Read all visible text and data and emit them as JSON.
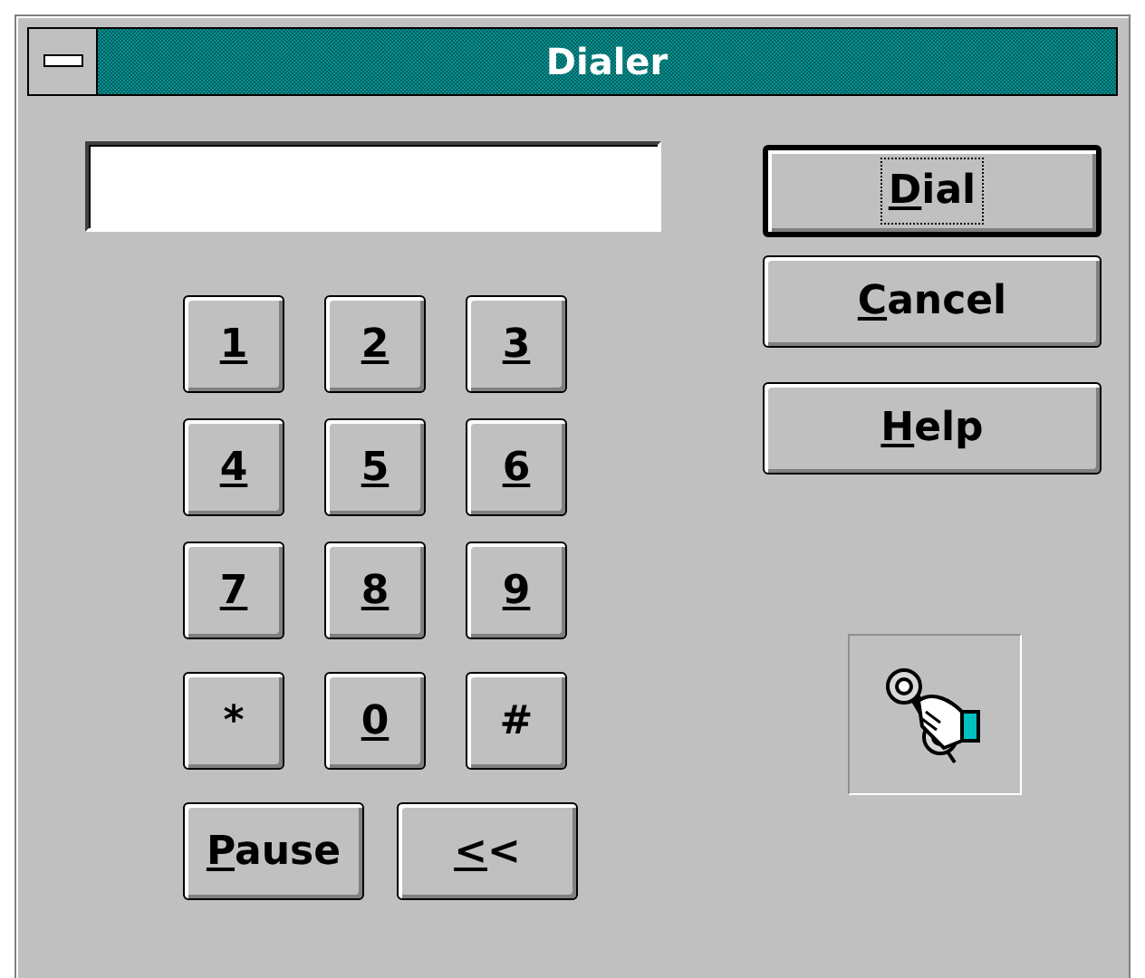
{
  "window": {
    "title": "Dialer"
  },
  "keypad": [
    {
      "underlined": "1"
    },
    {
      "underlined": "2"
    },
    {
      "underlined": "3"
    },
    {
      "underlined": "4"
    },
    {
      "underlined": "5"
    },
    {
      "underlined": "6"
    },
    {
      "underlined": "7"
    },
    {
      "underlined": "8"
    },
    {
      "underlined": "9"
    },
    {
      "plain": "*"
    },
    {
      "underlined": "0"
    },
    {
      "plain": "#"
    }
  ],
  "extra_keys": [
    {
      "underlined": "P",
      "plain": "ause"
    },
    {
      "underlined": "<",
      "plain": "<"
    }
  ],
  "actions": [
    {
      "underlined": "D",
      "plain": "ial",
      "default": true,
      "focused": true
    },
    {
      "underlined": "C",
      "plain": "ancel",
      "default": false,
      "focused": false
    },
    {
      "underlined": "H",
      "plain": "elp",
      "default": false,
      "focused": false
    }
  ]
}
